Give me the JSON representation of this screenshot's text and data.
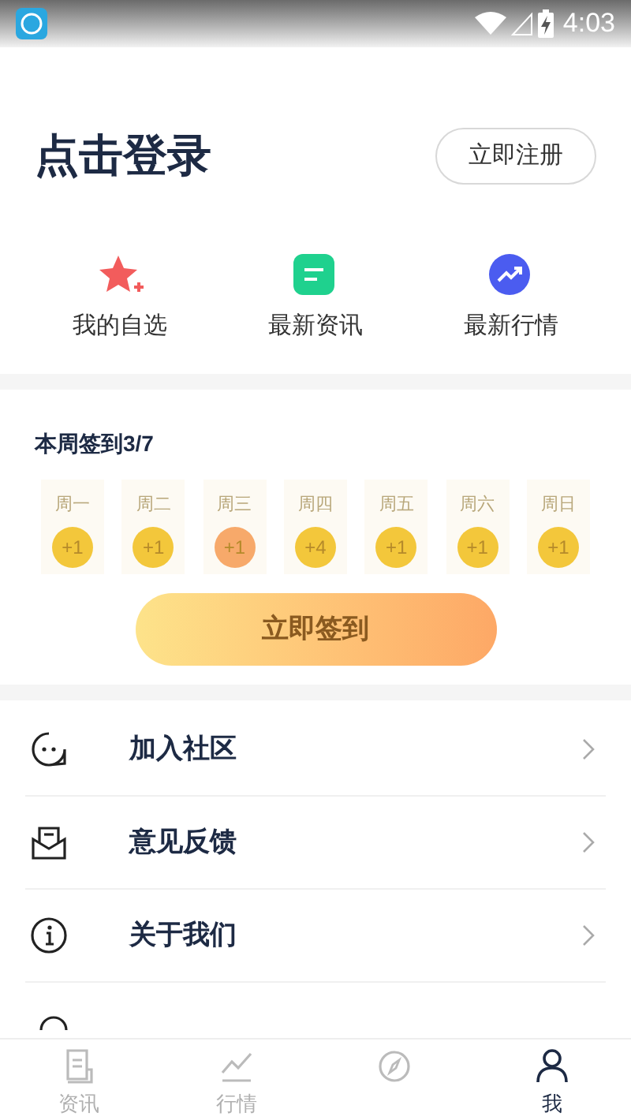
{
  "status_bar": {
    "time": "4:03"
  },
  "header": {
    "title": "点击登录",
    "register_button": "立即注册"
  },
  "shortcuts": [
    {
      "kind": "star",
      "label": "我的自选"
    },
    {
      "kind": "news",
      "label": "最新资讯"
    },
    {
      "kind": "trend",
      "label": "最新行情"
    }
  ],
  "checkin": {
    "title": "本周签到3/7",
    "button": "立即签到",
    "days": [
      {
        "label": "周一",
        "reward": "+1",
        "selected": false
      },
      {
        "label": "周二",
        "reward": "+1",
        "selected": false
      },
      {
        "label": "周三",
        "reward": "+1",
        "selected": true
      },
      {
        "label": "周四",
        "reward": "+4",
        "selected": false
      },
      {
        "label": "周五",
        "reward": "+1",
        "selected": false
      },
      {
        "label": "周六",
        "reward": "+1",
        "selected": false
      },
      {
        "label": "周日",
        "reward": "+1",
        "selected": false
      }
    ]
  },
  "menu": [
    {
      "kind": "chat",
      "label": "加入社区"
    },
    {
      "kind": "mail",
      "label": "意见反馈"
    },
    {
      "kind": "info",
      "label": "关于我们"
    },
    {
      "kind": "partial"
    }
  ],
  "tab_bar": [
    {
      "kind": "doc",
      "label": "资讯",
      "selected": false
    },
    {
      "kind": "chart",
      "label": "行情",
      "selected": false
    },
    {
      "kind": "compass",
      "selected": false
    },
    {
      "kind": "person",
      "label": "我",
      "selected": true
    }
  ]
}
